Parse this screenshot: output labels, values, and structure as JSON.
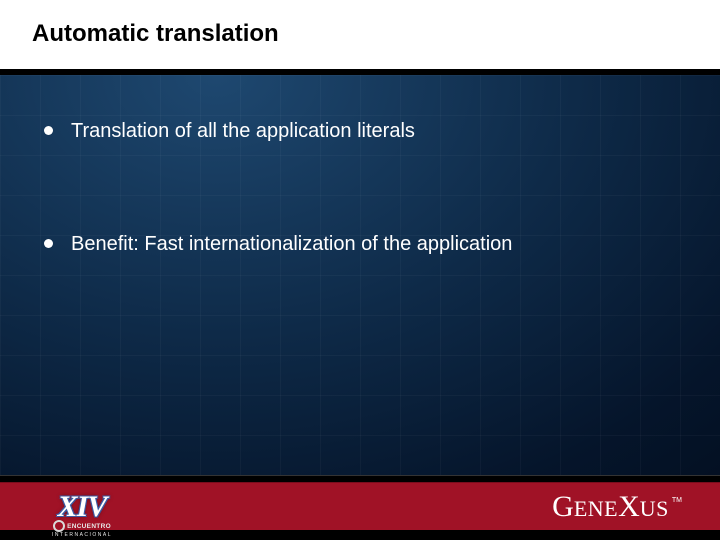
{
  "title": "Automatic translation",
  "bullets": [
    "Translation of all the application literals",
    "Benefit: Fast internationalization of the application"
  ],
  "footer": {
    "badge": {
      "roman": "XIV",
      "line1": "ENCUENTRO",
      "line2": "INTERNACIONAL"
    },
    "logo": {
      "g": "G",
      "ene": "ENE",
      "x": "X",
      "us": "US",
      "tm": "TM"
    }
  },
  "colors": {
    "footer_red": "#a01226",
    "bg_deep": "#05152b",
    "bg_light": "#1e4870"
  }
}
